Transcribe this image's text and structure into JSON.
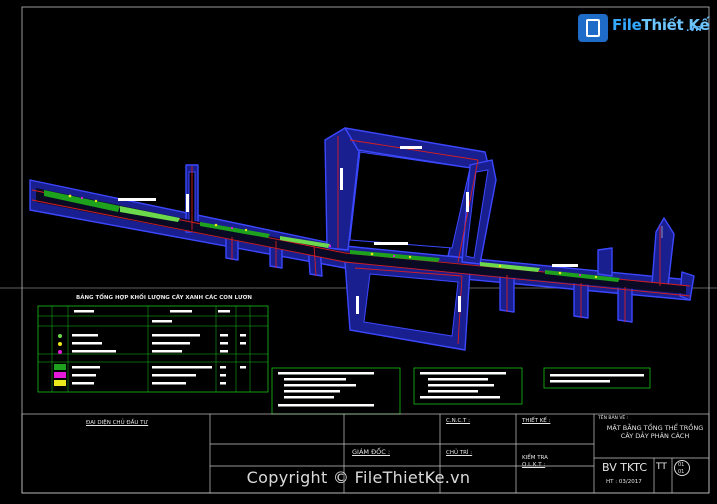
{
  "watermark": {
    "logo_brand": "File",
    "logo_brand_accent": "Thiết Kế",
    "logo_domain": ".vn",
    "logo_icon": "file-icon",
    "copyright": "Copyright © FileThietKe.vn"
  },
  "table": {
    "title": "BẢNG TỔNG HỢP KHỐI LƯỢNG CÂY XANH CÁC CON LƯƠN"
  },
  "title_block": {
    "owner_rep": "ĐẠI DIỆN CHỦ ĐẦU TƯ",
    "director": "GIÁM ĐỐC :",
    "cnct": "C.N.C.T :",
    "designer": "THIẾT KẾ :",
    "chief": "CHỦ TRÌ :",
    "checker": "KIỂM TRA",
    "qlkt": "Q.L.K.T :",
    "drawing_name_label": "TÊN BẢN VẼ :",
    "drawing_title": "MẶT BẰNG TỔNG THỂ TRỒNG CÂY DẢY PHÂN CÁCH",
    "code": "BV TKTC",
    "date": "HT : 03/2017",
    "sheet_prefix": "TT",
    "sheet_number": "01",
    "sheet_total": "01"
  },
  "colors": {
    "road_edge": "#2f3bd6",
    "road_fill": "#000000",
    "centerline": "#d41f1f",
    "vegetation": "#1ea21e",
    "vegetation_light": "#6bd94b",
    "label_white": "#ffffff",
    "frame": "#cfcfcf",
    "table_border": "#19c119",
    "magenta": "#e31ad9",
    "yellow": "#e8e81c"
  }
}
